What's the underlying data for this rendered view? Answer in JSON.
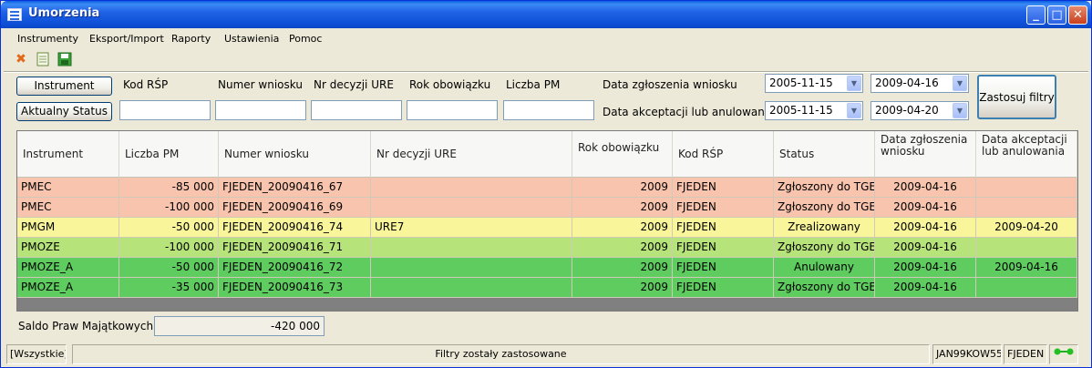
{
  "window": {
    "title": "Umorzenia"
  },
  "menu": [
    "Instrumenty",
    "Eksport/Import",
    "Raporty",
    "Ustawienia",
    "Pomoc"
  ],
  "toolbar": {
    "icons": [
      "delete-icon",
      "document-icon",
      "save-icon"
    ]
  },
  "filters": {
    "instrument_button": "Instrument",
    "status_button": "Aktualny Status",
    "labels": {
      "kod_rsp": "Kod RŚP",
      "numer_wniosku": "Numer wniosku",
      "nr_decyzji": "Nr decyzji URE",
      "rok": "Rok obowiązku",
      "liczba_pm": "Liczba PM",
      "data_zgloszenia": "Data zgłoszenia wniosku",
      "data_akceptacji": "Data akceptacji lub anulowania"
    },
    "inputs": {
      "kod_rsp": "",
      "numer_wniosku": "",
      "nr_decyzji": "",
      "rok": "",
      "liczba_pm": ""
    },
    "dates": {
      "zgloszenia_from": "2005-11-15",
      "zgloszenia_to": "2009-04-16",
      "akceptacji_from": "2005-11-15",
      "akceptacji_to": "2009-04-20"
    },
    "apply_button": "Zastosuj filtry"
  },
  "table": {
    "columns": [
      "Instrument",
      "Liczba PM",
      "Numer wniosku",
      "Nr decyzji URE",
      "Rok obowiązku",
      "Kod RŚP",
      "Status",
      "Data zgłoszenia wniosku",
      "Data akceptacji lub anulowania"
    ],
    "rows": [
      {
        "cells": [
          "PMEC",
          "-85 000",
          "FJEDEN_20090416_67",
          "",
          "2009",
          "FJEDEN",
          "Zgłoszony do TGE",
          "2009-04-16",
          ""
        ],
        "color": "#f8c4ad"
      },
      {
        "cells": [
          "PMEC",
          "-100 000",
          "FJEDEN_20090416_69",
          "",
          "2009",
          "FJEDEN",
          "Zgłoszony do TGE",
          "2009-04-16",
          ""
        ],
        "color": "#f8c4ad"
      },
      {
        "cells": [
          "PMGM",
          "-50 000",
          "FJEDEN_20090416_74",
          "URE7",
          "2009",
          "FJEDEN",
          "Zrealizowany",
          "2009-04-16",
          "2009-04-20"
        ],
        "color": "#f8f59a"
      },
      {
        "cells": [
          "PMOZE",
          "-100 000",
          "FJEDEN_20090416_71",
          "",
          "2009",
          "FJEDEN",
          "Zgłoszony do TGE",
          "2009-04-16",
          ""
        ],
        "color": "#b7e47a"
      },
      {
        "cells": [
          "PMOZE_A",
          "-50 000",
          "FJEDEN_20090416_72",
          "",
          "2009",
          "FJEDEN",
          "Anulowany",
          "2009-04-16",
          "2009-04-16"
        ],
        "color": "#5fcc5f"
      },
      {
        "cells": [
          "PMOZE_A",
          "-35 000",
          "FJEDEN_20090416_73",
          "",
          "2009",
          "FJEDEN",
          "Zgłoszony do TGE",
          "2009-04-16",
          ""
        ],
        "color": "#5fcc5f"
      }
    ]
  },
  "saldo": {
    "label": "Saldo Praw Majątkowych:",
    "value": "-420 000"
  },
  "status_bar": {
    "filter": "[Wszystkie]",
    "message": "Filtry zostały zastosowane",
    "user": "JAN99KOW55",
    "company": "FJEDEN"
  }
}
